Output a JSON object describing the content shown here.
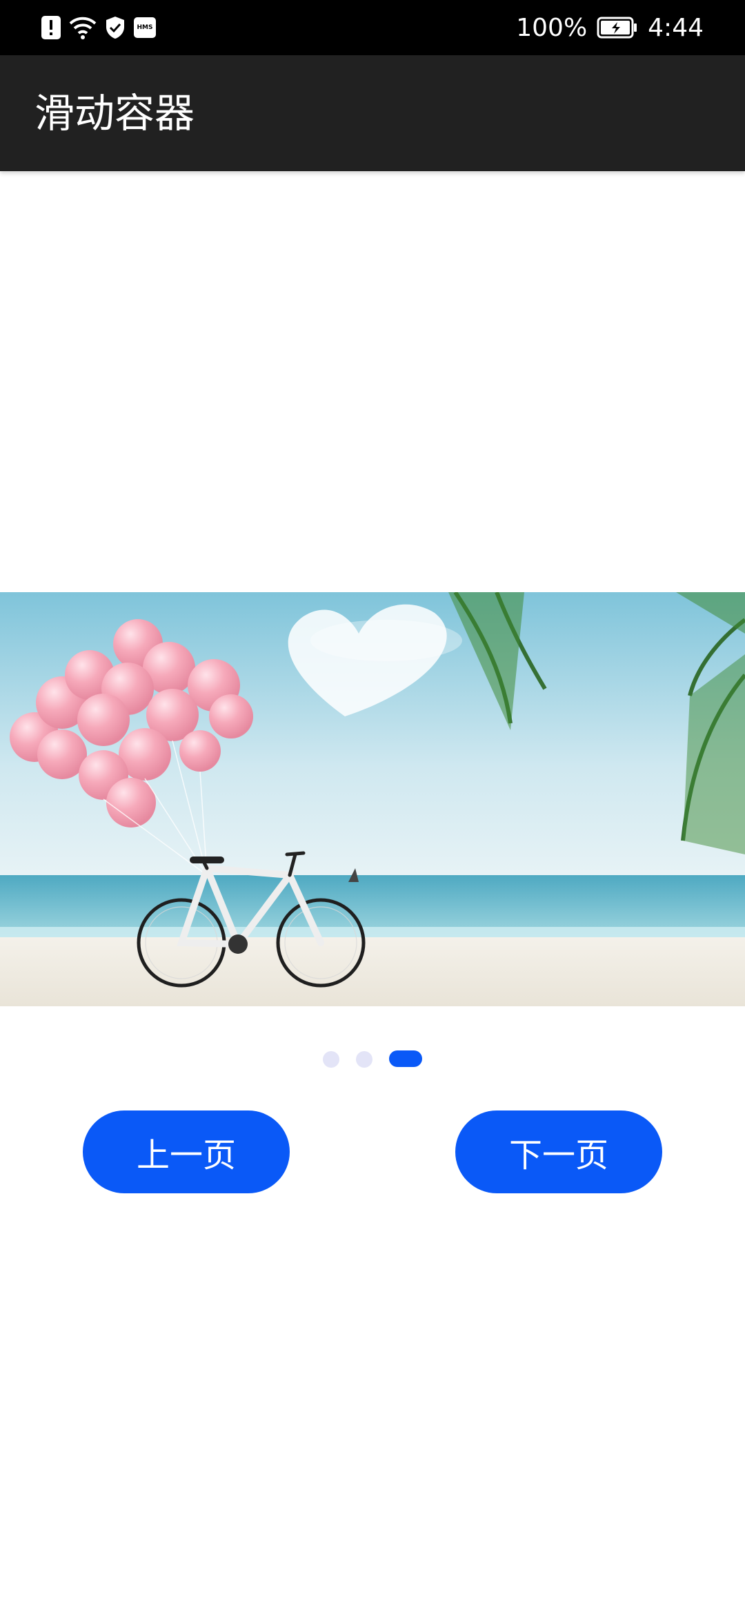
{
  "status_bar": {
    "icons": [
      "alert-icon",
      "wifi-icon",
      "shield-check-icon",
      "hms-icon"
    ],
    "hms_label": "HMS",
    "battery_percent": "100%",
    "battery_icon": "charging-battery-icon",
    "time": "4:44"
  },
  "app_bar": {
    "title": "滑动容器"
  },
  "swiper": {
    "current_slide": "beach-bicycle-balloons",
    "total_pages": 3,
    "current_page": 3
  },
  "controls": {
    "prev_label": "上一页",
    "next_label": "下一页"
  },
  "colors": {
    "accent": "#0a59f7",
    "inactive_dot": "#e3e4f7",
    "app_bar": "#212121",
    "status_bar": "#000000"
  }
}
